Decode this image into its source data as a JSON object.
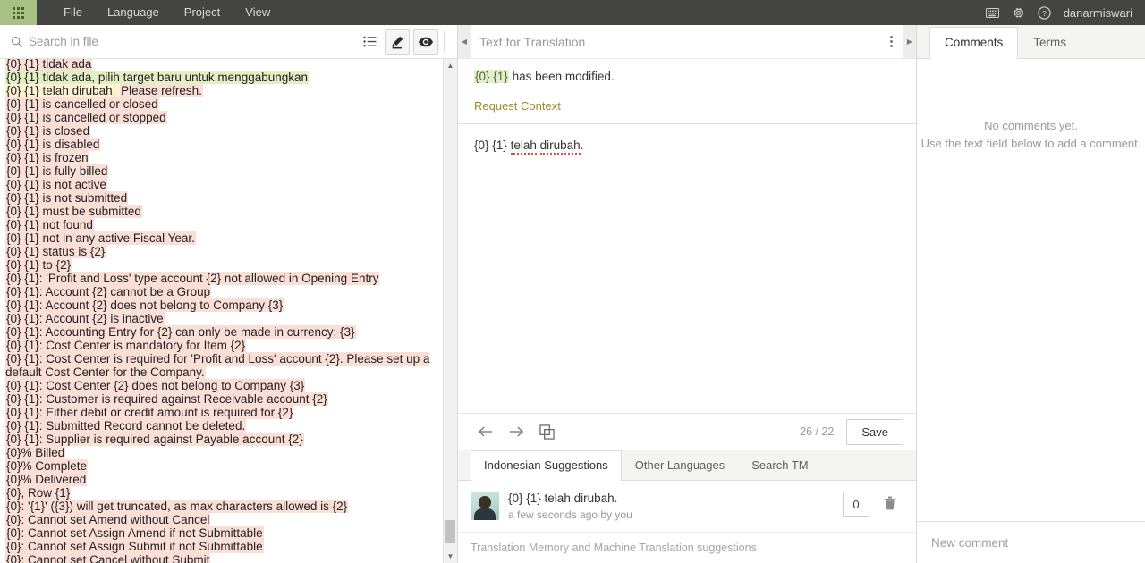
{
  "topbar": {
    "apps_icon": "grid-apps-icon",
    "menu": [
      {
        "label": "File"
      },
      {
        "label": "Language"
      },
      {
        "label": "Project"
      },
      {
        "label": "View"
      }
    ],
    "icons": [
      {
        "name": "keyboard-icon",
        "glyph": "⌨"
      },
      {
        "name": "gear-icon",
        "glyph": "⚙"
      },
      {
        "name": "help-icon",
        "glyph": "?"
      }
    ],
    "username": "danarmiswari"
  },
  "left_panel": {
    "search": {
      "placeholder": "Search in file",
      "value": ""
    },
    "tools": [
      {
        "name": "list-view-icon",
        "active": false
      },
      {
        "name": "edit-mode-icon",
        "active": true
      },
      {
        "name": "preview-mode-icon",
        "active": true
      }
    ],
    "strings": [
      {
        "text": "{0} {1} tidak ada",
        "hl": "hl-pink"
      },
      {
        "text": "{0} {1} tidak ada, pilih target baru untuk menggabungkan",
        "hl": "hl-green"
      },
      {
        "text": "{0} {1} telah dirubah. Please refresh.",
        "hl": "hl-cream",
        "selected": true
      },
      {
        "text": "{0} {1} is cancelled or closed",
        "hl": "hl-pink"
      },
      {
        "text": "{0} {1} is cancelled or stopped",
        "hl": "hl-pink"
      },
      {
        "text": "{0} {1} is closed",
        "hl": "hl-pink"
      },
      {
        "text": "{0} {1} is disabled",
        "hl": "hl-pink"
      },
      {
        "text": "{0} {1} is frozen",
        "hl": "hl-pink"
      },
      {
        "text": "{0} {1} is fully billed",
        "hl": "hl-pink"
      },
      {
        "text": "{0} {1} is not active",
        "hl": "hl-pink"
      },
      {
        "text": "{0} {1} is not submitted",
        "hl": "hl-pink"
      },
      {
        "text": "{0} {1} must be submitted",
        "hl": "hl-pink"
      },
      {
        "text": "{0} {1} not found",
        "hl": "hl-pink"
      },
      {
        "text": "{0} {1} not in any active Fiscal Year.",
        "hl": "hl-pink"
      },
      {
        "text": "{0} {1} status is {2}",
        "hl": "hl-pink"
      },
      {
        "text": "{0} {1} to {2}",
        "hl": "hl-pink"
      },
      {
        "text": "{0} {1}: 'Profit and Loss' type account {2} not allowed in Opening Entry",
        "hl": "hl-pink"
      },
      {
        "text": "{0} {1}: Account {2} cannot be a Group",
        "hl": "hl-pink"
      },
      {
        "text": "{0} {1}: Account {2} does not belong to Company {3}",
        "hl": "hl-pink"
      },
      {
        "text": "{0} {1}: Account {2} is inactive",
        "hl": "hl-pink"
      },
      {
        "text": "{0} {1}: Accounting Entry for {2} can only be made in currency: {3}",
        "hl": "hl-pink"
      },
      {
        "text": "{0} {1}: Cost Center is mandatory for Item {2}",
        "hl": "hl-pink"
      },
      {
        "text": "{0} {1}: Cost Center is required for 'Profit and Loss' account {2}. Please set up a default Cost Center for the Company.",
        "hl": "hl-pink"
      },
      {
        "text": "{0} {1}: Cost Center {2} does not belong to Company {3}",
        "hl": "hl-pink"
      },
      {
        "text": "{0} {1}: Customer is required against Receivable account {2}",
        "hl": "hl-pink"
      },
      {
        "text": "{0} {1}: Either debit or credit amount is required for {2}",
        "hl": "hl-pink"
      },
      {
        "text": "{0} {1}: Submitted Record cannot be deleted.",
        "hl": "hl-pink"
      },
      {
        "text": "{0} {1}: Supplier is required against Payable account {2}",
        "hl": "hl-pink"
      },
      {
        "text": "{0}% Billed",
        "hl": "hl-pink"
      },
      {
        "text": "{0}% Complete",
        "hl": "hl-pink"
      },
      {
        "text": "{0}% Delivered",
        "hl": "hl-pink"
      },
      {
        "text": "{0}, Row {1}",
        "hl": "hl-pink"
      },
      {
        "text": "{0}: '{1}' ({3}) will get truncated, as max characters allowed is {2}",
        "hl": "hl-pink"
      },
      {
        "text": "{0}: Cannot set Amend without Cancel",
        "hl": "hl-pink"
      },
      {
        "text": "{0}: Cannot set Assign Amend if not Submittable",
        "hl": "hl-pink"
      },
      {
        "text": "{0}: Cannot set Assign Submit if not Submittable",
        "hl": "hl-pink"
      },
      {
        "text": "{0}: Cannot set Cancel without Submit",
        "hl": "hl-pink"
      }
    ]
  },
  "middle_panel": {
    "header_title": "Text for Translation",
    "source": {
      "prefix_placeholders": "{0} {1}",
      "rest": " has been modified.",
      "request_context_label": "Request Context"
    },
    "target": {
      "placeholders": "{0} {1}",
      "word_1": "telah",
      "word_2": "dirubah",
      "trailing": "."
    },
    "edit_tools": [
      {
        "name": "previous-segment-icon",
        "glyph": "←"
      },
      {
        "name": "next-segment-icon",
        "glyph": "→"
      },
      {
        "name": "copy-source-icon",
        "glyph": "⧉"
      }
    ],
    "counter": "26 / 22",
    "save_label": "Save",
    "suggestion_tabs": [
      {
        "label": "Indonesian Suggestions",
        "active": true
      },
      {
        "label": "Other Languages",
        "active": false
      },
      {
        "label": "Search TM",
        "active": false
      }
    ],
    "suggestion": {
      "text": "{0} {1} telah dirubah.",
      "meta": "a few seconds ago by you",
      "score": "0",
      "delete_icon": "trash-icon"
    },
    "tm_note": "Translation Memory and Machine Translation suggestions"
  },
  "right_panel": {
    "tabs": [
      {
        "label": "Comments",
        "active": true
      },
      {
        "label": "Terms",
        "active": false
      }
    ],
    "empty_line1": "No comments yet.",
    "empty_line2": "Use the text field below to add a comment.",
    "new_comment_placeholder": "New comment"
  },
  "colors": {
    "topbar_bg": "#444442",
    "apps_green": "#a7c083",
    "highlight_pink": "#fadfd6",
    "highlight_green": "#e2eec4",
    "highlight_cream": "#fdf3d3",
    "placeholder_green": "#e2f0cf",
    "request_context": "#a08a2a"
  }
}
